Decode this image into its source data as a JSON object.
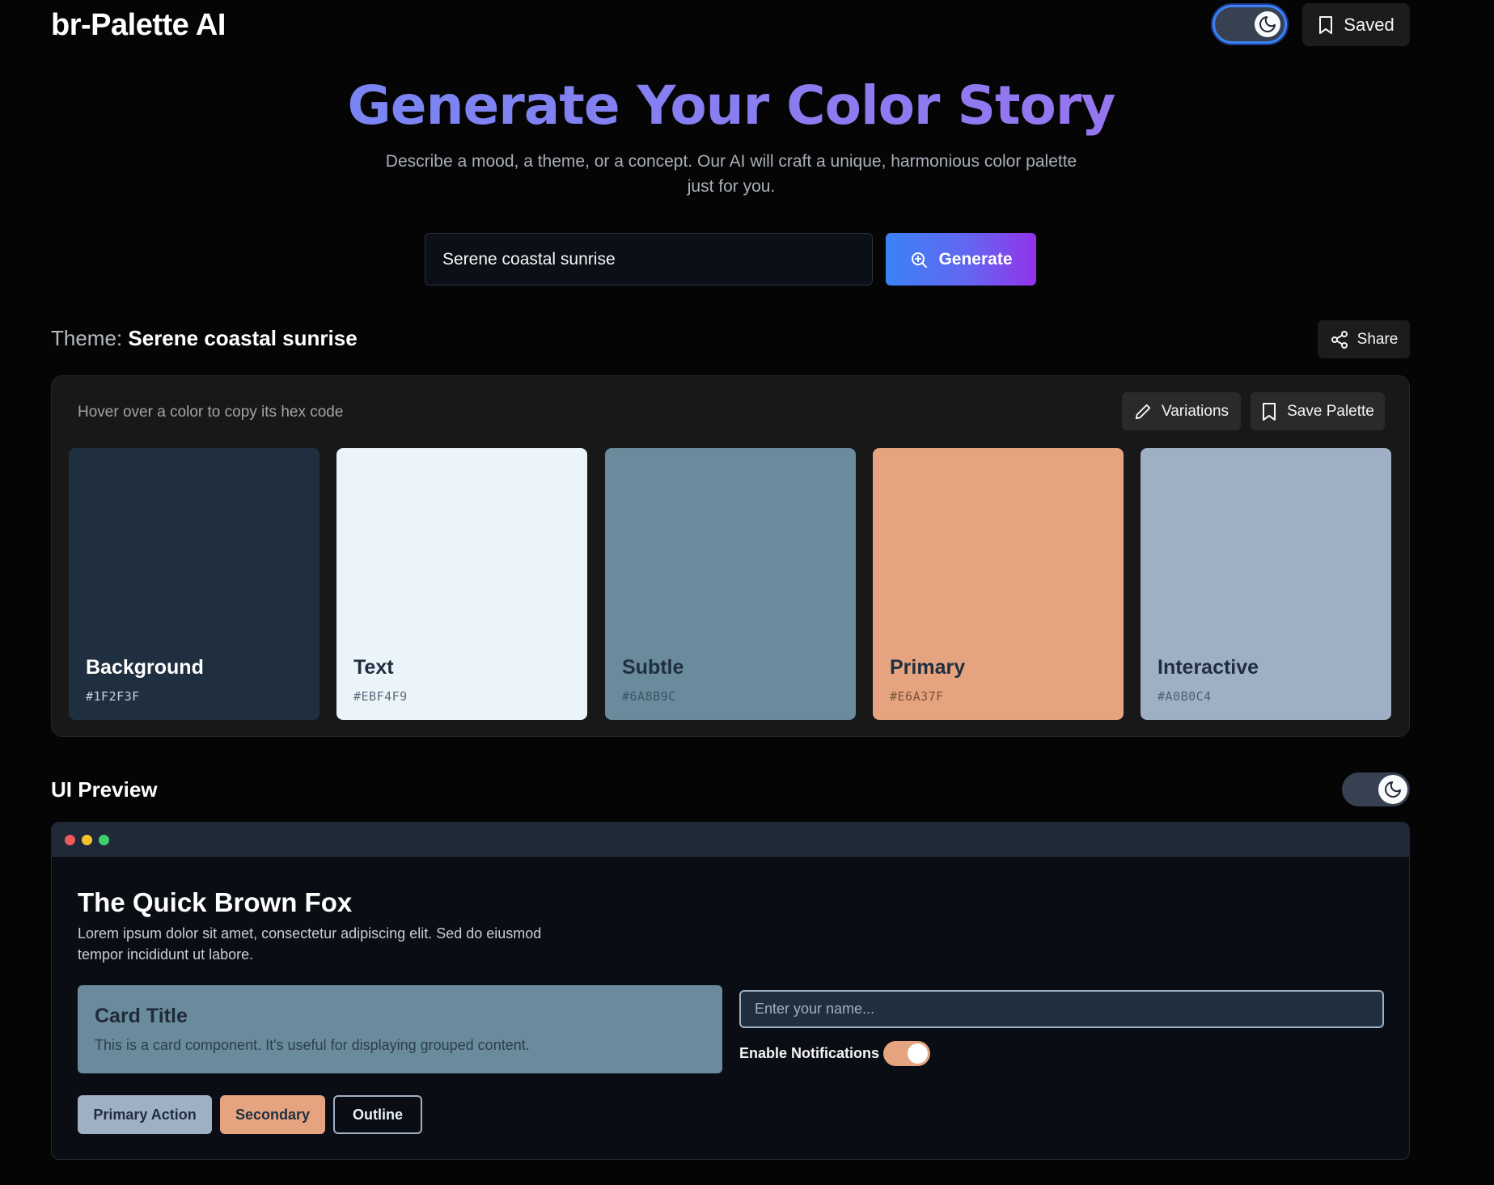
{
  "header": {
    "app_title": "br-Palette AI",
    "saved_label": "Saved",
    "dark_mode_on": true
  },
  "hero": {
    "title": "Generate Your Color Story",
    "subtitle": "Describe a mood, a theme, or a concept. Our AI will craft a unique, harmonious color palette just for you."
  },
  "prompt": {
    "value": "Serene coastal sunrise",
    "generate_label": "Generate"
  },
  "theme": {
    "prefix": "Theme:",
    "name": "Serene coastal sunrise",
    "share_label": "Share"
  },
  "palette": {
    "hint": "Hover over a color to copy its hex code",
    "variations_label": "Variations",
    "save_label": "Save Palette",
    "colors": [
      {
        "name": "Background",
        "hex": "#1F2F3F",
        "text_color": "#ffffff",
        "hex_color": "#c8d2dc"
      },
      {
        "name": "Text",
        "hex": "#EBF4F9",
        "text_color": "#1f2f3f",
        "hex_color": "#5b6b7b"
      },
      {
        "name": "Subtle",
        "hex": "#6A8B9C",
        "text_color": "#1f2f3f",
        "hex_color": "#3a5566"
      },
      {
        "name": "Primary",
        "hex": "#E6A37F",
        "text_color": "#1f2f3f",
        "hex_color": "#7a4f38"
      },
      {
        "name": "Interactive",
        "hex": "#A0B0C4",
        "text_color": "#1f2f3f",
        "hex_color": "#4f5f72"
      }
    ]
  },
  "preview": {
    "heading": "UI Preview",
    "dark_mode_on": true,
    "title": "The Quick Brown Fox",
    "body": "Lorem ipsum dolor sit amet, consectetur adipiscing elit. Sed do eiusmod tempor incididunt ut labore.",
    "card_title": "Card Title",
    "card_text": "This is a card component. It's useful for displaying grouped content.",
    "name_placeholder": "Enter your name...",
    "notifications_label": "Enable Notifications",
    "notifications_on": true,
    "primary_button": "Primary Action",
    "secondary_button": "Secondary",
    "outline_button": "Outline"
  }
}
